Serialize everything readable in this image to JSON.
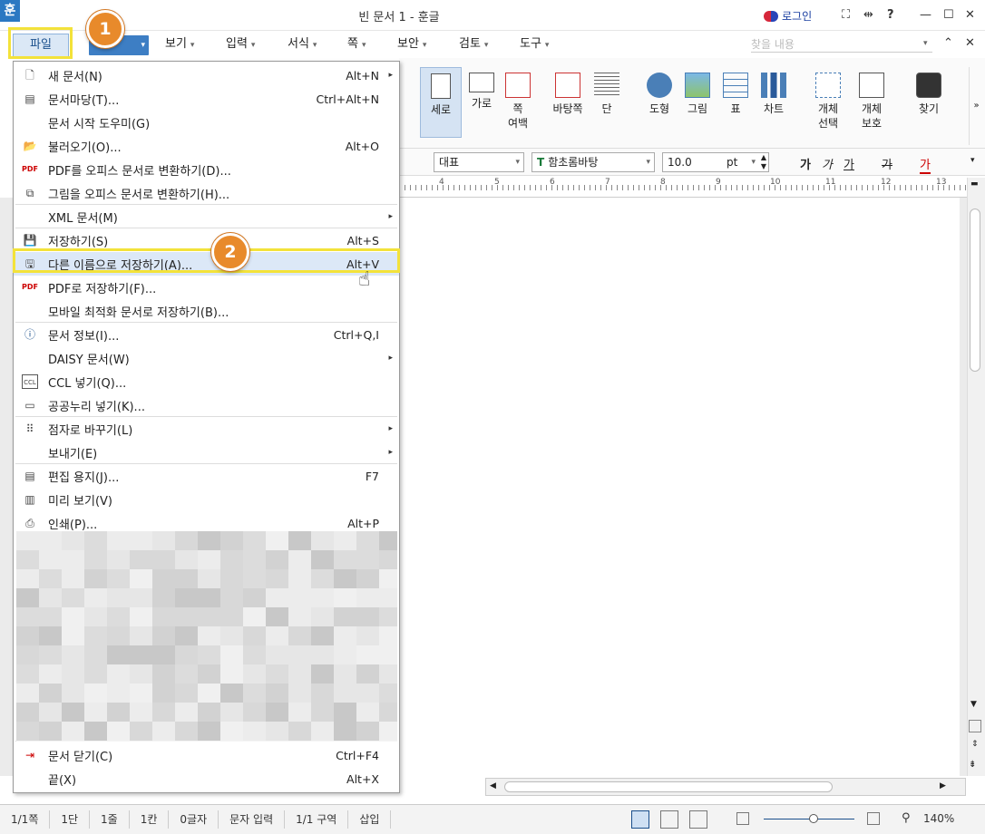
{
  "window": {
    "title": "빈 문서 1 - 훈글",
    "app_icon": "훈",
    "login": "로그인"
  },
  "titlebar_icons": {
    "fullscreen": "⛶",
    "split": "⇹",
    "help": "?",
    "minimize": "—",
    "maximize": "☐",
    "close": "✕"
  },
  "menubar": {
    "file": "파일",
    "tabs": [
      {
        "label": "보기"
      },
      {
        "label": "입력"
      },
      {
        "label": "서식"
      },
      {
        "label": "쪽"
      },
      {
        "label": "보안"
      },
      {
        "label": "검토"
      },
      {
        "label": "도구"
      }
    ],
    "search_placeholder": "찾을 내용"
  },
  "ribbon": {
    "buttons": [
      {
        "label": "세로",
        "icon": "portrait-icon"
      },
      {
        "label": "가로",
        "icon": "landscape-icon"
      },
      {
        "label": "쪽\n여백",
        "icon": "margin-icon"
      },
      {
        "label": "바탕쪽",
        "icon": "master-page-icon"
      },
      {
        "label": "단",
        "icon": "columns-icon"
      },
      {
        "label": "도형",
        "icon": "shape-icon"
      },
      {
        "label": "그림",
        "icon": "picture-icon"
      },
      {
        "label": "표",
        "icon": "table-icon"
      },
      {
        "label": "차트",
        "icon": "chart-icon"
      },
      {
        "label": "개체\n선택",
        "icon": "select-object-icon"
      },
      {
        "label": "개체\n보호",
        "icon": "protect-object-icon"
      },
      {
        "label": "찾기",
        "icon": "find-icon"
      }
    ]
  },
  "format": {
    "style": "대표",
    "font": "함초롬바탕",
    "size": "10.0",
    "unit": "pt",
    "bold": "가",
    "italic": "가",
    "underline": "가",
    "strike": "가",
    "color": "가"
  },
  "ruler": {
    "ticks": [
      "4",
      "5",
      "6",
      "7",
      "8",
      "9",
      "10",
      "11",
      "12",
      "13"
    ]
  },
  "file_menu": {
    "items": [
      {
        "label": "새 문서(N)",
        "shortcut": "Alt+N",
        "submenu": true,
        "icon": "new-doc-icon"
      },
      {
        "label": "문서마당(T)...",
        "shortcut": "Ctrl+Alt+N",
        "icon": "template-icon"
      },
      {
        "label": "문서 시작 도우미(G)",
        "shortcut": ""
      },
      {
        "label": "불러오기(O)...",
        "shortcut": "Alt+O",
        "icon": "open-folder-icon"
      },
      {
        "label": "PDF를 오피스 문서로 변환하기(D)...",
        "shortcut": "",
        "icon": "pdf-convert-icon"
      },
      {
        "label": "그림을 오피스 문서로 변환하기(H)...",
        "shortcut": "",
        "icon": "image-convert-icon"
      },
      {
        "label": "XML 문서(M)",
        "shortcut": "",
        "submenu": true
      },
      {
        "label": "저장하기(S)",
        "shortcut": "Alt+S",
        "icon": "save-icon"
      },
      {
        "label": "다른 이름으로 저장하기(A)...",
        "shortcut": "Alt+V",
        "icon": "save-as-icon"
      },
      {
        "label": "PDF로 저장하기(F)...",
        "shortcut": "",
        "icon": "save-pdf-icon"
      },
      {
        "label": "모바일 최적화 문서로 저장하기(B)...",
        "shortcut": ""
      },
      {
        "label": "문서 정보(I)...",
        "shortcut": "Ctrl+Q,I",
        "icon": "info-icon"
      },
      {
        "label": "DAISY 문서(W)",
        "shortcut": "",
        "submenu": true
      },
      {
        "label": "CCL 넣기(Q)...",
        "shortcut": "",
        "icon": "ccl-icon"
      },
      {
        "label": "공공누리 넣기(K)...",
        "shortcut": "",
        "icon": "open-license-icon"
      },
      {
        "label": "점자로 바꾸기(L)",
        "shortcut": "",
        "submenu": true,
        "icon": "braille-icon"
      },
      {
        "label": "보내기(E)",
        "shortcut": "",
        "submenu": true
      },
      {
        "label": "편집 용지(J)...",
        "shortcut": "F7",
        "icon": "page-setup-icon"
      },
      {
        "label": "미리 보기(V)",
        "shortcut": "",
        "icon": "preview-icon"
      },
      {
        "label": "인쇄(P)...",
        "shortcut": "Alt+P",
        "icon": "print-icon"
      },
      {
        "label": "문서 닫기(C)",
        "shortcut": "Ctrl+F4",
        "icon": "close-doc-icon"
      },
      {
        "label": "끝(X)",
        "shortcut": "Alt+X"
      }
    ]
  },
  "annotations": {
    "step1": "1",
    "step2": "2"
  },
  "status": {
    "page": "1/1쪽",
    "col": "1단",
    "line": "1줄",
    "pos": "1칸",
    "chars": "0글자",
    "mode": "문자 입력",
    "section": "1/1 구역",
    "insert": "삽입",
    "zoom": "140%"
  }
}
